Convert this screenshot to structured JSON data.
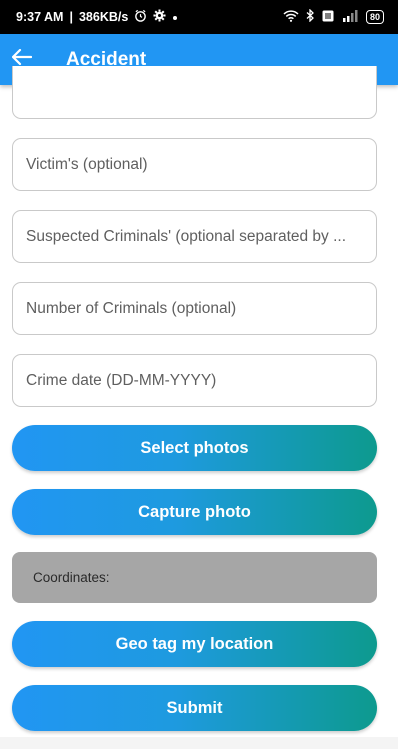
{
  "status_bar": {
    "time": "9:37 AM",
    "speed": "386KB/s",
    "battery": "80"
  },
  "app_bar": {
    "title": "Accident"
  },
  "form": {
    "victims_placeholder": "Victim's (optional)",
    "suspects_placeholder": "Suspected Criminals' (optional separated by ...",
    "num_criminals_placeholder": "Number of Criminals (optional)",
    "crime_date_placeholder": "Crime date (DD-MM-YYYY)"
  },
  "buttons": {
    "select_photos": "Select photos",
    "capture_photo": "Capture photo",
    "geo_tag": "Geo tag my location",
    "submit": "Submit"
  },
  "coordinates": {
    "label": "Coordinates:"
  },
  "colors": {
    "app_bar": "#2196f3",
    "gradient_start": "#2196f3",
    "gradient_end": "#0d9a8e",
    "coordinates_bg": "#a6a6a6"
  }
}
